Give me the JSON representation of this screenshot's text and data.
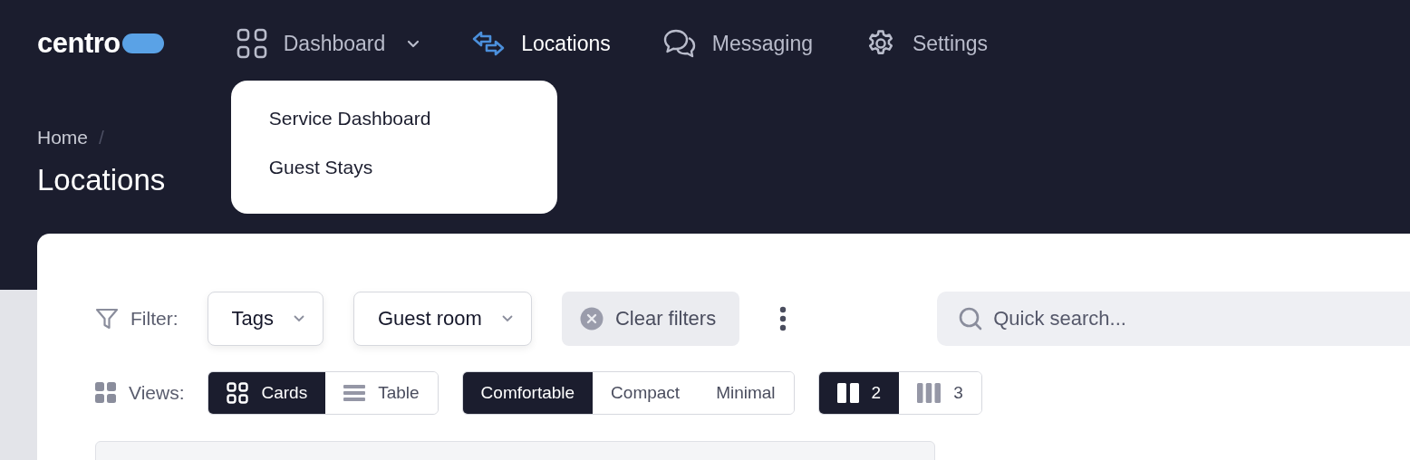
{
  "logo": {
    "text": "centro"
  },
  "nav": [
    {
      "label": "Dashboard",
      "kind": "grid",
      "selected": false,
      "menu": [
        "Service Dashboard",
        "Guest Stays"
      ]
    },
    {
      "label": "Locations",
      "kind": "arrows",
      "selected": true
    },
    {
      "label": "Messaging",
      "kind": "chat",
      "selected": false
    },
    {
      "label": "Settings",
      "kind": "gear",
      "selected": false
    }
  ],
  "breadcrumb": {
    "items": [
      "Home"
    ],
    "separator": "/"
  },
  "title": "Locations",
  "filter": {
    "label": "Filter:",
    "dropdowns": [
      "Tags",
      "Guest room"
    ],
    "clear": "Clear filters",
    "search": {
      "placeholder": "Quick search..."
    }
  },
  "views": {
    "label": "Views:",
    "groups": [
      {
        "options": [
          {
            "label": "Cards",
            "kind": "grid",
            "selected": true
          },
          {
            "label": "Table",
            "kind": "rows",
            "selected": false
          }
        ]
      },
      {
        "options": [
          {
            "label": "Comfortable",
            "selected": true
          },
          {
            "label": "Compact",
            "selected": false
          },
          {
            "label": "Minimal",
            "selected": false
          }
        ]
      },
      {
        "options": [
          {
            "label": "2",
            "kind": "cols2",
            "selected": true
          },
          {
            "label": "3",
            "kind": "cols3",
            "selected": false
          }
        ]
      }
    ]
  }
}
